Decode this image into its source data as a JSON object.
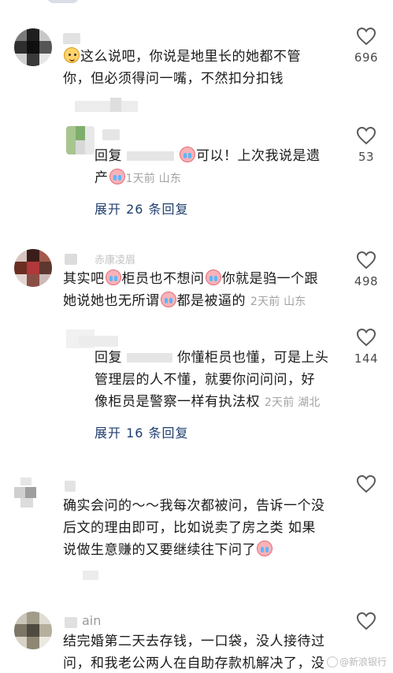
{
  "comments": [
    {
      "text_a": "这么说吧，你说是地里长的她都不管",
      "text_b": "你，但必须得问一嘴，不然扣分扣钱",
      "likes": "696",
      "replies": [
        {
          "prefix": "回复",
          "text_a": "可以！上次我说是遗",
          "text_b": "产",
          "meta": "1天前 山东",
          "likes": "53"
        }
      ],
      "expand_label": "展开 26 条回复"
    },
    {
      "text_a_1": "其实吧",
      "text_a_2": "柜员也不想问",
      "text_a_3": "你就是驺一个跟",
      "text_b_1": "她说她也无所谓",
      "text_b_2": "都是被逼的",
      "meta": "2天前 山东",
      "likes": "498",
      "nick_fragment": "赤康凌眉",
      "replies": [
        {
          "prefix": "回复",
          "text_a": "你懂柜员也懂，可是上头",
          "text_b": "管理层的人不懂，就要你问问问，好",
          "text_c": "像柜员是警察一样有执法权",
          "meta": "2天前 湖北",
          "likes": "144"
        }
      ],
      "expand_label": "展开 16 条回复"
    },
    {
      "text_a": "确实会问的～～我每次都被问，告诉一个没",
      "text_b": "后文的理由即可，比如说卖了房之类 如果",
      "text_c": "说做生意赚的又要继续往下问了",
      "likes": ""
    },
    {
      "nick_fragment": "ain",
      "text_a": "结完婚第二天去存钱，一口袋，没人接待过",
      "text_b": "问，和我老公两人在自助存款机解决了，没",
      "likes": ""
    }
  ],
  "watermark": "@新浪银行",
  "icons": {
    "like": "heart-outline-icon",
    "emoji_cry": "crying-face-emoji",
    "emoji_doge": "doge-emoji"
  },
  "colors": {
    "text": "#1a1a1a",
    "meta": "#a3a3a3",
    "expand": "#1f3d6e",
    "icon": "#5a5a5a"
  }
}
